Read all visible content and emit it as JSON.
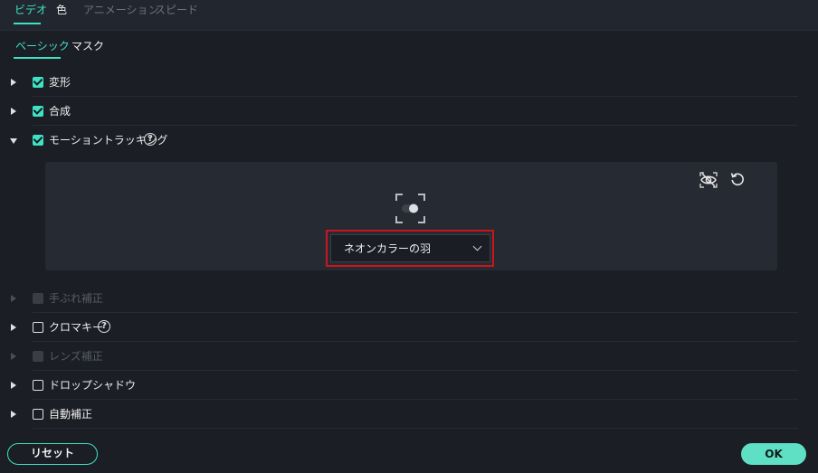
{
  "top_tabs": [
    {
      "label": "ビデオ",
      "active": true
    },
    {
      "label": "色",
      "active": false
    },
    {
      "label": "アニメーション",
      "active": false
    },
    {
      "label": "スピード",
      "active": false
    }
  ],
  "sub_tabs": [
    {
      "label": "ベーシック",
      "active": true
    },
    {
      "label": "マスク",
      "active": false
    }
  ],
  "sections": [
    {
      "label": "変形",
      "checked": true,
      "expanded": false,
      "enabled": true
    },
    {
      "label": "合成",
      "checked": true,
      "expanded": false,
      "enabled": true
    },
    {
      "label": "モーショントラッキング",
      "checked": true,
      "expanded": true,
      "enabled": true,
      "help": "?"
    },
    {
      "label": "手ぶれ補正",
      "checked": false,
      "expanded": false,
      "enabled": false
    },
    {
      "label": "クロマキー",
      "checked": false,
      "expanded": false,
      "enabled": true,
      "help": "?"
    },
    {
      "label": "レンズ補正",
      "checked": false,
      "expanded": false,
      "enabled": false
    },
    {
      "label": "ドロップシャドウ",
      "checked": false,
      "expanded": false,
      "enabled": true
    },
    {
      "label": "自動補正",
      "checked": false,
      "expanded": false,
      "enabled": true
    }
  ],
  "motion_tracking": {
    "selected_element": "ネオンカラーの羽",
    "icons": [
      "hide-eye-icon",
      "reset-icon",
      "focus-target-icon"
    ]
  },
  "footer": {
    "reset_label": "リセット",
    "ok_label": "OK"
  },
  "colors": {
    "accent": "#3de2c4",
    "highlight_frame": "#d0131b",
    "background": "#1b1e25"
  }
}
